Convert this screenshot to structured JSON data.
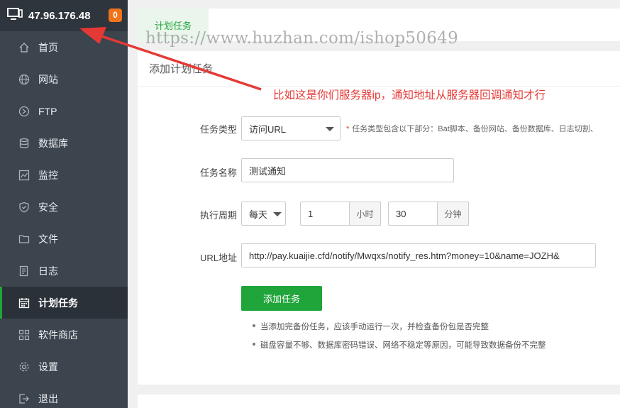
{
  "server": {
    "ip": "47.96.176.48",
    "badge_count": "0"
  },
  "sidebar": {
    "items": [
      {
        "label": "首页",
        "icon": "home-icon"
      },
      {
        "label": "网站",
        "icon": "globe-icon"
      },
      {
        "label": "FTP",
        "icon": "ftp-icon"
      },
      {
        "label": "数据库",
        "icon": "database-icon"
      },
      {
        "label": "监控",
        "icon": "monitor-icon"
      },
      {
        "label": "安全",
        "icon": "shield-icon"
      },
      {
        "label": "文件",
        "icon": "folder-icon"
      },
      {
        "label": "日志",
        "icon": "log-icon"
      },
      {
        "label": "计划任务",
        "icon": "calendar-icon",
        "active": true
      },
      {
        "label": "软件商店",
        "icon": "grid-icon"
      },
      {
        "label": "设置",
        "icon": "gear-icon"
      },
      {
        "label": "退出",
        "icon": "logout-icon"
      }
    ]
  },
  "tabs": {
    "active": "计划任务"
  },
  "card": {
    "title": "添加计划任务"
  },
  "form": {
    "task_type": {
      "label": "任务类型",
      "value": "访问URL",
      "hint": "任务类型包含以下部分：Bat脚本、备份网站、备份数据库、日志切割、"
    },
    "task_name": {
      "label": "任务名称",
      "value": "测试通知"
    },
    "cycle": {
      "label": "执行周期",
      "period": "每天",
      "hour": "1",
      "hour_unit": "小时",
      "minute": "30",
      "minute_unit": "分钟"
    },
    "url": {
      "label": "URL地址",
      "value": "http://pay.kuaijie.cfd/notify/Mwqxs/notify_res.htm?money=10&name=JOZH&"
    },
    "submit_label": "添加任务"
  },
  "notes": [
    "当添加完备份任务，应该手动运行一次，并检查备份包是否完整",
    "磁盘容量不够、数据库密码错误、网络不稳定等原因，可能导致数据备份不完整"
  ],
  "overlay": {
    "watermark": "https://www.huzhan.com/ishop50649",
    "annotation": "比如这是你们服务器ip，通知地址从服务器回调通知才行",
    "annotation_color": "#e53935"
  },
  "colors": {
    "accent": "#20a53a",
    "sidebar_bg": "#3c444d",
    "badge": "#f0731c"
  }
}
